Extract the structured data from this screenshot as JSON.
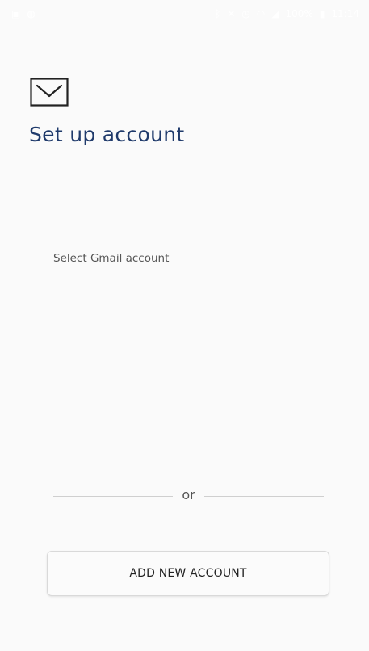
{
  "status_bar": {
    "left_icons": [
      "image-icon",
      "messenger-icon"
    ],
    "right_icons": [
      "bluetooth-icon",
      "mute-icon",
      "alarm-icon",
      "wifi-icon",
      "signal-icon",
      "battery-icon"
    ],
    "battery_percent": "100%",
    "time": "11:14"
  },
  "header": {
    "icon": "mail-icon",
    "title": "Set up account"
  },
  "content": {
    "select_label": "Select Gmail account"
  },
  "divider": {
    "text": "or"
  },
  "actions": {
    "add_account_label": "ADD NEW ACCOUNT"
  }
}
